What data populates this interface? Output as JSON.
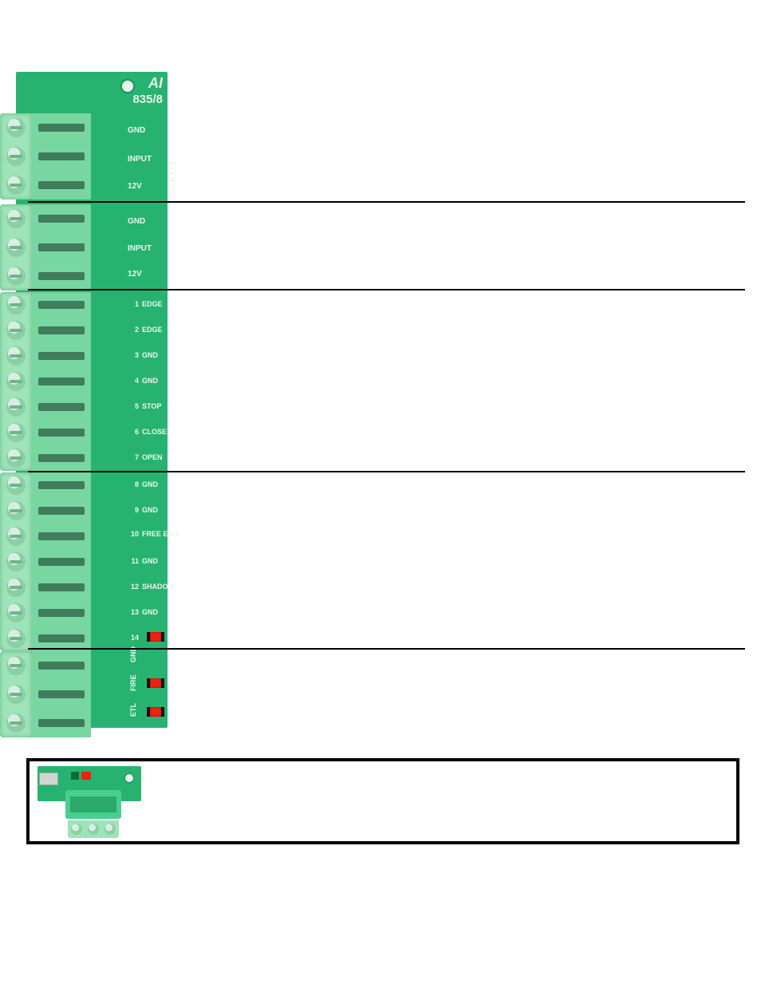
{
  "pcb": {
    "logo_fragment": "AI",
    "part_number_fragment": "835/8",
    "blocks": {
      "operate_top": {
        "pins": [
          "GND",
          "INPUT",
          "12V"
        ],
        "side_label": "OPERATE"
      },
      "operate_bottom": {
        "pins": [
          "GND",
          "INPUT",
          "12V"
        ]
      },
      "terminals_1_7": [
        {
          "num": "1",
          "label": "EDGE"
        },
        {
          "num": "2",
          "label": "EDGE"
        },
        {
          "num": "3",
          "label": "GND"
        },
        {
          "num": "4",
          "label": "GND"
        },
        {
          "num": "5",
          "label": "STOP"
        },
        {
          "num": "6",
          "label": "CLOSE"
        },
        {
          "num": "7",
          "label": "OPEN"
        }
      ],
      "terminals_8_14": [
        {
          "num": "8",
          "label": "GND"
        },
        {
          "num": "9",
          "label": "GND"
        },
        {
          "num": "10",
          "label": "FREE EXIT"
        },
        {
          "num": "11",
          "label": "GND"
        },
        {
          "num": "12",
          "label": "SHADOW"
        },
        {
          "num": "13",
          "label": "GND"
        },
        {
          "num": "14",
          "label": ""
        }
      ],
      "bottom_3": {
        "pins": [
          "GND",
          "FIRE",
          "ETL"
        ]
      }
    }
  },
  "radio_receiver": {
    "description": "Radio receiver module (3-pin plug)"
  }
}
